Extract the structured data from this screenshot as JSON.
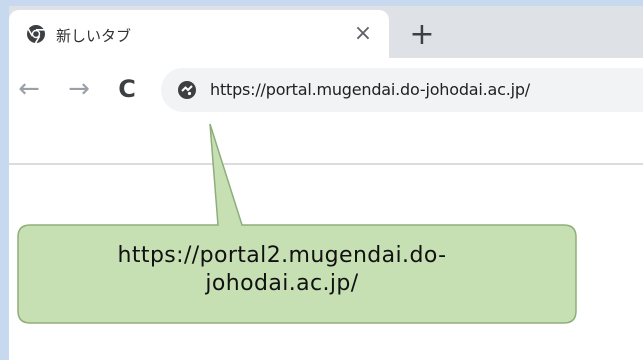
{
  "browser": {
    "tab": {
      "title": "新しいタブ",
      "close_glyph": "×",
      "favicon": "chrome-icon"
    },
    "new_tab_glyph": "+",
    "toolbar": {
      "back_glyph": "←",
      "forward_glyph": "→",
      "reload_glyph": "C",
      "site_icon": "site-info-icon",
      "url": "https://portal.mugendai.do-johodai.ac.jp/"
    }
  },
  "callout": {
    "line1": "https://portal2.mugendai.do-",
    "line2": "johodai.ac.jp/",
    "fill_color": "#c6e0b4",
    "border_color": "#8fad7a"
  },
  "colors": {
    "background": "#c7d9ef",
    "tabstrip": "#dee1e6",
    "omnibox": "#f1f3f4"
  }
}
